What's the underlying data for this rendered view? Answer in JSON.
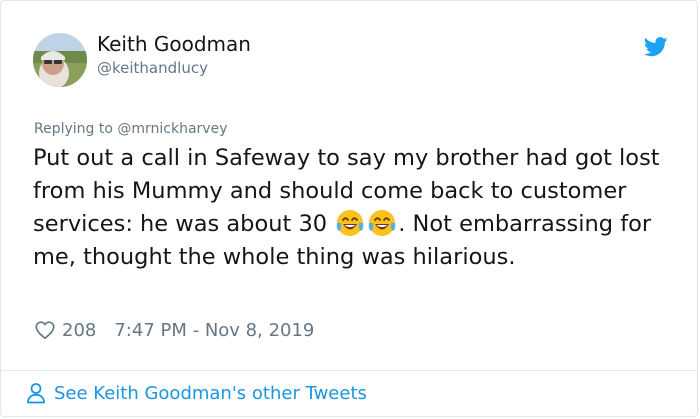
{
  "author": {
    "name": "Keith Goodman",
    "handle": "@keithandlucy"
  },
  "reply_to": "Replying to @mrnickharvey",
  "tweet": {
    "text_before_emoji": "Put out a call in Safeway to say my brother had got lost from his Mummy and should come back to customer services: he was about 30 ",
    "text_after_emoji": ". Not embarrassing for me, thought the whole thing was hilarious."
  },
  "meta": {
    "likes": "208",
    "timestamp": "7:47 PM - Nov 8, 2019"
  },
  "footer": {
    "other_tweets_link": "See Keith Goodman's other Tweets"
  },
  "icons": {
    "brand": "twitter-bird-icon",
    "emoji": "face-with-tears-of-joy",
    "like": "heart-outline-icon",
    "profile": "person-icon"
  },
  "colors": {
    "twitter_blue": "#1da1f2",
    "link_blue": "#1b95e0",
    "secondary_text": "#657786",
    "primary_text": "#14171a"
  }
}
